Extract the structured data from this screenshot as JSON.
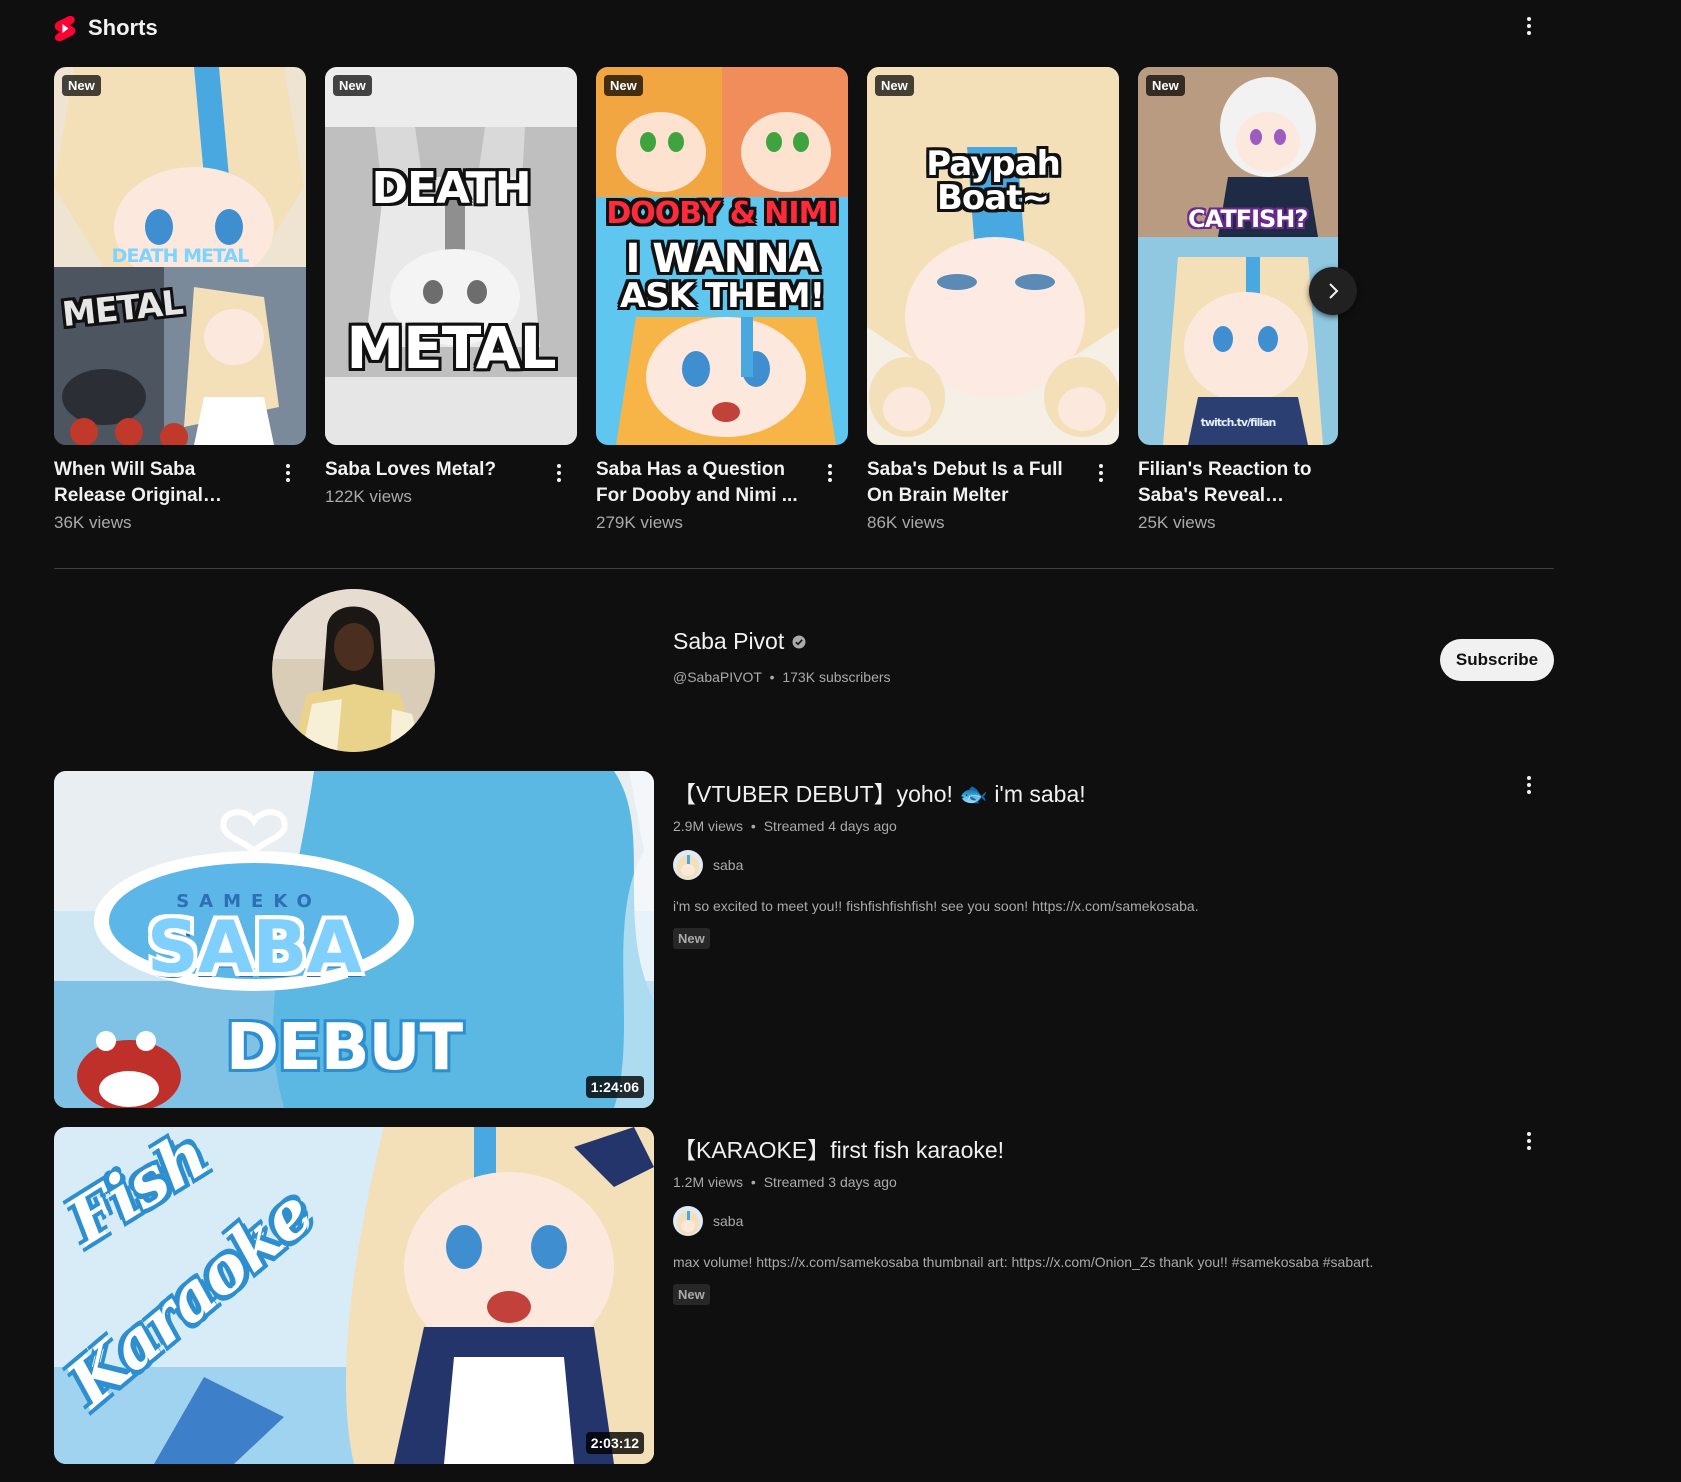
{
  "shorts": {
    "title": "Shorts",
    "badge_new": "New",
    "items": [
      {
        "title": "When Will Saba Release Original Music? Death ...",
        "views": "36K views",
        "thumb_text_1": "DEATH METAL",
        "thumb_text_2": "METAL"
      },
      {
        "title": "Saba Loves Metal?",
        "views": "122K views",
        "thumb_text_1": "DEATH",
        "thumb_text_2": "METAL"
      },
      {
        "title": "Saba Has a Question For Dooby and Nimi ...",
        "views": "279K views",
        "thumb_text_1": "DOOBY & NIMI",
        "thumb_text_2": "I WANNA",
        "thumb_text_3": "ASK THEM!"
      },
      {
        "title": "Saba's Debut Is a Full On Brain Melter",
        "views": "86K views",
        "thumb_text_1": "Paypah Boat~"
      },
      {
        "title": "Filian's Reaction to Saba's Reveal #vtuber ...",
        "views": "25K views",
        "thumb_text_1": "CATFISH?",
        "thumb_text_2": "twitch.tv/filian"
      }
    ]
  },
  "channel": {
    "name": "Saba Pivot",
    "handle": "@SabaPIVOT",
    "separator": "•",
    "subscribers": "173K subscribers",
    "subscribe_label": "Subscribe"
  },
  "videos": [
    {
      "title": "【VTUBER DEBUT】yoho! 🐟 i'm saba!",
      "views": "2.9M views",
      "streamed": "Streamed 4 days ago",
      "channel": "saba",
      "description": "i'm so excited to meet you!! fishfishfishfish! see you soon! https://x.com/samekosaba.",
      "tag": "New",
      "duration": "1:24:06",
      "thumb_text_1": "SAMEKO",
      "thumb_text_2": "SABA",
      "thumb_text_3": "DEBUT"
    },
    {
      "title": "【KARAOKE】first fish karaoke!",
      "views": "1.2M views",
      "streamed": "Streamed 3 days ago",
      "channel": "saba",
      "description": "max volume! https://x.com/samekosaba thumbnail art: https://x.com/Onion_Zs thank you!! #samekosaba #sabart.",
      "tag": "New",
      "duration": "2:03:12",
      "thumb_text_1": "Fish",
      "thumb_text_2": "Karaoke"
    }
  ],
  "colors": {
    "shorts_red": "#ff0033",
    "background": "#0f0f0f",
    "saba_blue": "#4aa8e0",
    "hair_blonde": "#f3dfb8"
  },
  "icons": {
    "shorts_logo": "shorts-logo-icon",
    "more": "more-vert-icon",
    "next": "chevron-right-icon",
    "verified": "verified-check-icon"
  }
}
